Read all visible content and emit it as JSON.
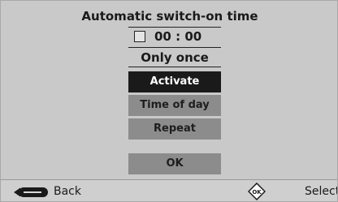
{
  "dialog": {
    "title": "Automatic switch-on time",
    "time_value": "00 : 00",
    "frequency": "Only once",
    "checkbox_checked": false
  },
  "menu": {
    "items": [
      {
        "label": "Activate",
        "selected": true
      },
      {
        "label": "Time of day",
        "selected": false
      },
      {
        "label": "Repeat",
        "selected": false
      }
    ],
    "ok_label": "OK"
  },
  "footer": {
    "back_label": "Back",
    "select_label": "Select",
    "back_icon": "back-arrow-icon",
    "ok_icon": "ok-diamond-icon"
  },
  "colors": {
    "background": "#c9c9c9",
    "button": "#8c8c8c",
    "button_selected": "#1a1a1a",
    "text": "#1a1a1a"
  }
}
